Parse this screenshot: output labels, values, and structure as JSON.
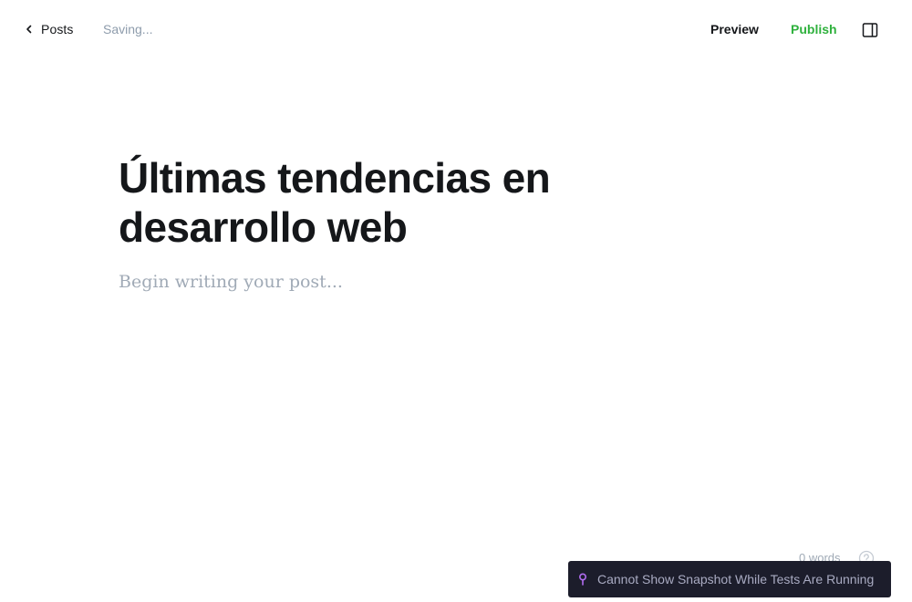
{
  "header": {
    "back_label": "Posts",
    "status_text": "Saving...",
    "preview_label": "Preview",
    "publish_label": "Publish"
  },
  "editor": {
    "title": "Últimas tendencias en desarrollo web",
    "body_placeholder": "Begin writing your post..."
  },
  "footer": {
    "word_count": "0 words"
  },
  "toast": {
    "message": "Cannot Show Snapshot While Tests Are Running"
  },
  "icons": {
    "back": "chevron-left-icon",
    "sidebar": "sidebar-panel-icon",
    "help": "question-circle-icon",
    "toast": "pin-icon"
  },
  "colors": {
    "publish": "#2fb13d",
    "muted": "#8e9cac",
    "toast_bg": "#1c1d2b",
    "toast_accent": "#b16cf0"
  }
}
